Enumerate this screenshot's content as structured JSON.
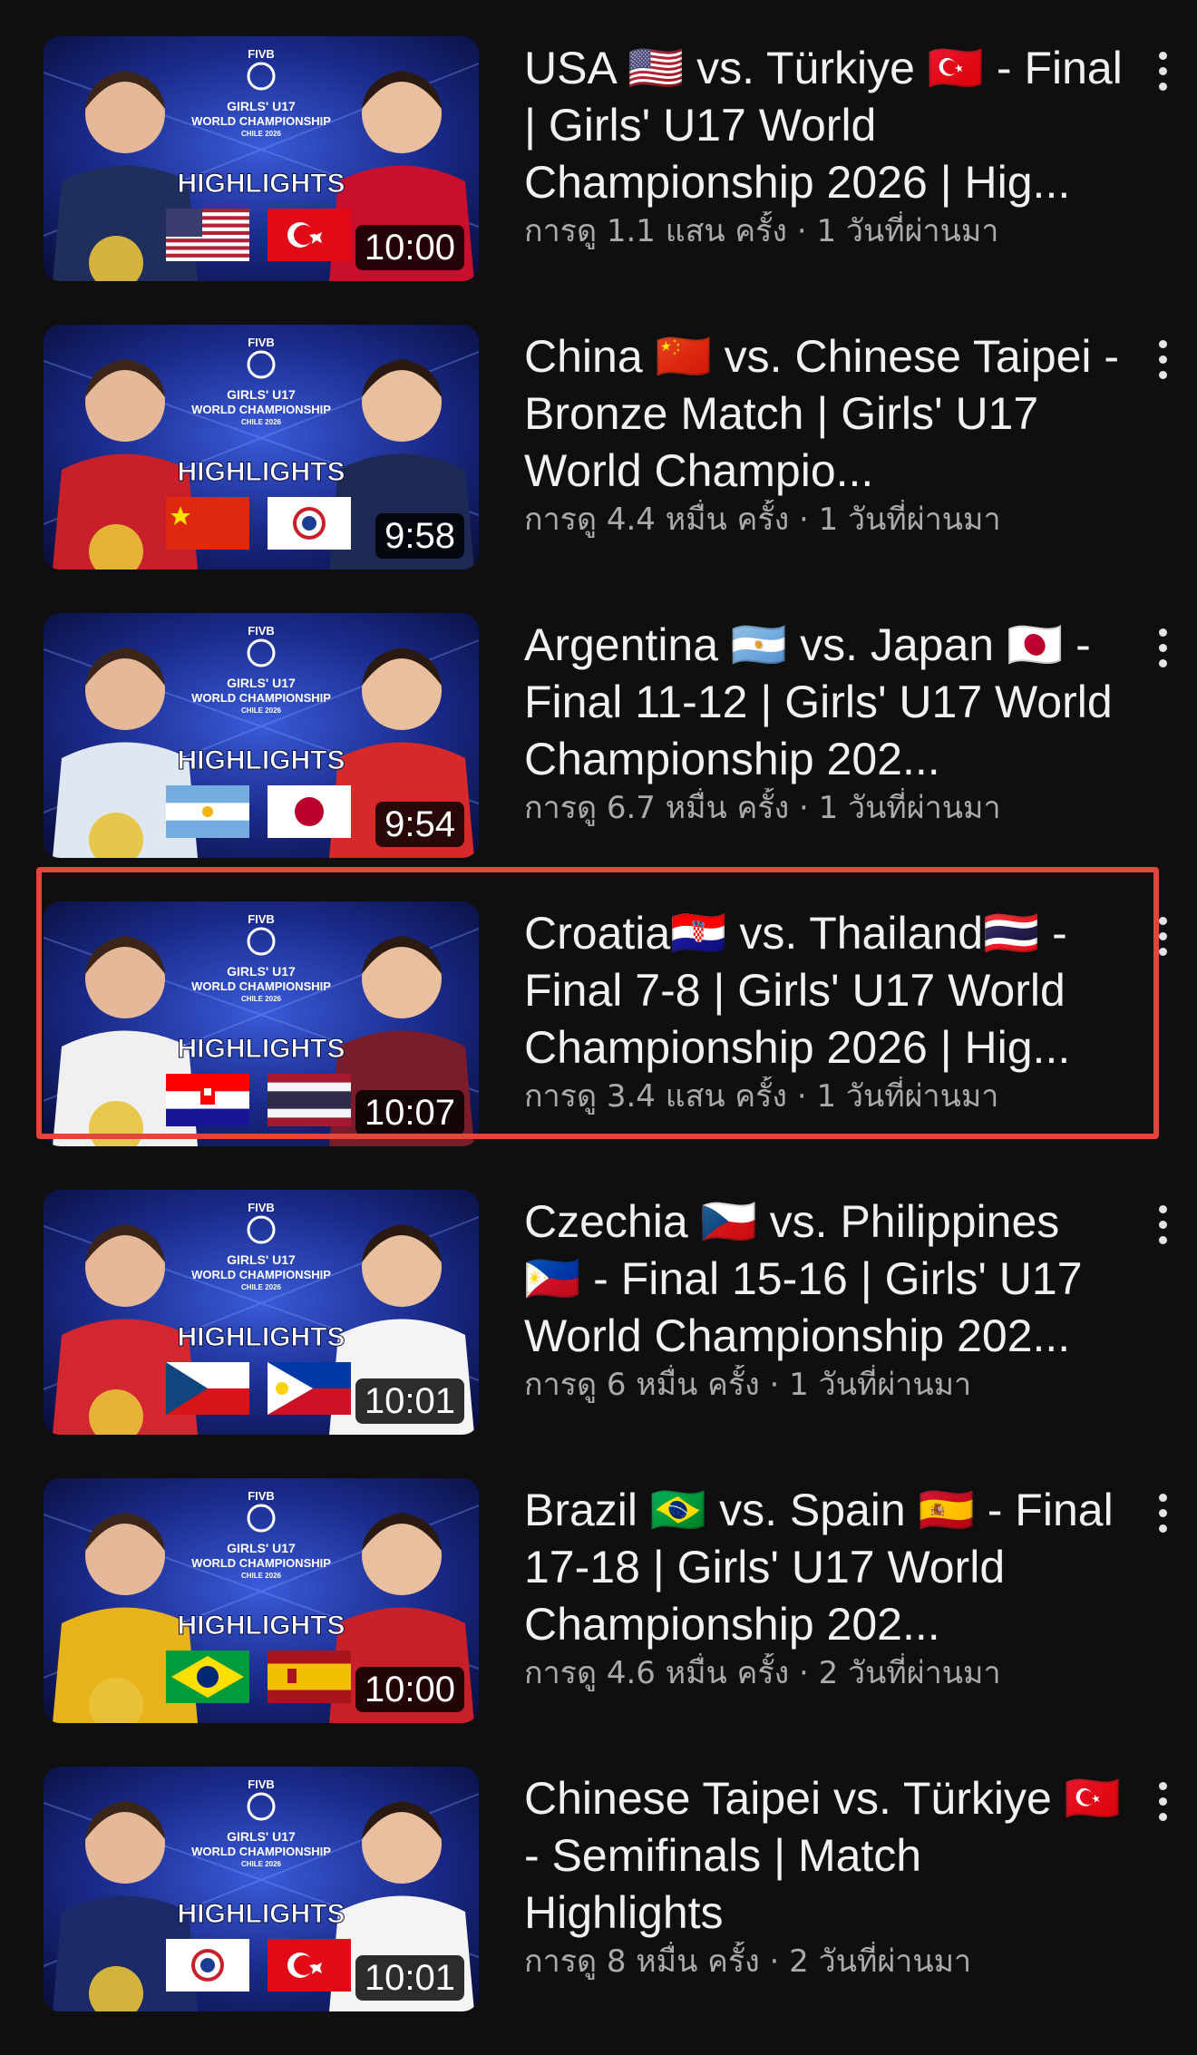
{
  "videos": [
    {
      "title": "USA 🇺🇸 vs. Türkiye 🇹🇷 - Final | Girls' U17 World Championship 2026 | Hig...",
      "meta": "การดู 1.1 แสน ครั้ง · 1 วันที่ผ่านมา",
      "duration": "10:00",
      "thumb": {
        "brand": "FIVB",
        "line1": "GIRLS' U17",
        "line2": "WORLD CHAMPIONSHIP",
        "line3": "CHILE 2026",
        "banner": "HIGHLIGHTS",
        "left_flag": "usa",
        "right_flag": "turkiye",
        "left_jersey": "#1f2e5c",
        "right_jersey": "#c8102e"
      }
    },
    {
      "title": "China 🇨🇳 vs. Chinese Taipei - Bronze Match | Girls' U17 World Champio...",
      "meta": "การดู 4.4 หมื่น ครั้ง · 1 วันที่ผ่านมา",
      "duration": "9:58",
      "thumb": {
        "brand": "FIVB",
        "line1": "GIRLS' U17",
        "line2": "WORLD CHAMPIONSHIP",
        "line3": "CHILE 2026",
        "banner": "HIGHLIGHTS",
        "left_flag": "china",
        "right_flag": "chinese-taipei",
        "left_jersey": "#c8202a",
        "right_jersey": "#1c2a55"
      }
    },
    {
      "title": "Argentina 🇦🇷 vs. Japan 🇯🇵 - Final 11-12 | Girls' U17 World Championship 202...",
      "meta": "การดู 6.7 หมื่น ครั้ง · 1 วันที่ผ่านมา",
      "duration": "9:54",
      "thumb": {
        "brand": "FIVB",
        "line1": "GIRLS' U17",
        "line2": "WORLD CHAMPIONSHIP",
        "line3": "CHILE 2026",
        "banner": "HIGHLIGHTS",
        "left_flag": "argentina",
        "right_flag": "japan",
        "left_jersey": "#dfe8f2",
        "right_jersey": "#d62a2a"
      }
    },
    {
      "title": "Croatia🇭🇷 vs. Thailand🇹🇭 - Final 7-8 | Girls' U17 World Championship 2026 | Hig...",
      "meta": "การดู 3.4 แสน ครั้ง · 1 วันที่ผ่านมา",
      "duration": "10:07",
      "thumb": {
        "brand": "FIVB",
        "line1": "GIRLS' U17",
        "line2": "WORLD CHAMPIONSHIP",
        "line3": "CHILE 2026",
        "banner": "HIGHLIGHTS",
        "left_flag": "croatia",
        "right_flag": "thailand",
        "left_jersey": "#f0f0f0",
        "right_jersey": "#7a1c2a"
      }
    },
    {
      "title": "Czechia 🇨🇿 vs. Philippines 🇵🇭 - Final 15-16 | Girls' U17 World Championship 202...",
      "meta": "การดู 6 หมื่น ครั้ง · 1 วันที่ผ่านมา",
      "duration": "10:01",
      "thumb": {
        "brand": "FIVB",
        "line1": "GIRLS' U17",
        "line2": "WORLD CHAMPIONSHIP",
        "line3": "CHILE 2026",
        "banner": "HIGHLIGHTS",
        "left_flag": "czechia",
        "right_flag": "philippines",
        "left_jersey": "#d22630",
        "right_jersey": "#f4f4f6"
      }
    },
    {
      "title": "Brazil 🇧🇷 vs. Spain 🇪🇸 - Final 17-18 | Girls' U17 World Championship 202...",
      "meta": "การดู 4.6 หมื่น ครั้ง · 2 วันที่ผ่านมา",
      "duration": "10:00",
      "thumb": {
        "brand": "FIVB",
        "line1": "GIRLS' U17",
        "line2": "WORLD CHAMPIONSHIP",
        "line3": "CHILE 2026",
        "banner": "HIGHLIGHTS",
        "left_flag": "brazil",
        "right_flag": "spain",
        "left_jersey": "#e8b21a",
        "right_jersey": "#c8202a"
      }
    },
    {
      "title": "Chinese Taipei vs. Türkiye 🇹🇷 - Semifinals | Match Highlights",
      "meta": "การดู 8 หมื่น ครั้ง · 2 วันที่ผ่านมา",
      "duration": "10:01",
      "thumb": {
        "brand": "FIVB",
        "line1": "GIRLS' U17",
        "line2": "WORLD CHAMPIONSHIP",
        "line3": "CHILE 2026",
        "banner": "HIGHLIGHTS",
        "left_flag": "chinese-taipei",
        "right_flag": "turkiye",
        "left_jersey": "#1c2a6a",
        "right_jersey": "#f4f4f4"
      }
    }
  ],
  "colors": {
    "highlight_border": "#e0463a",
    "background": "#0f0f0f",
    "meta_text": "#aaaaaa"
  }
}
